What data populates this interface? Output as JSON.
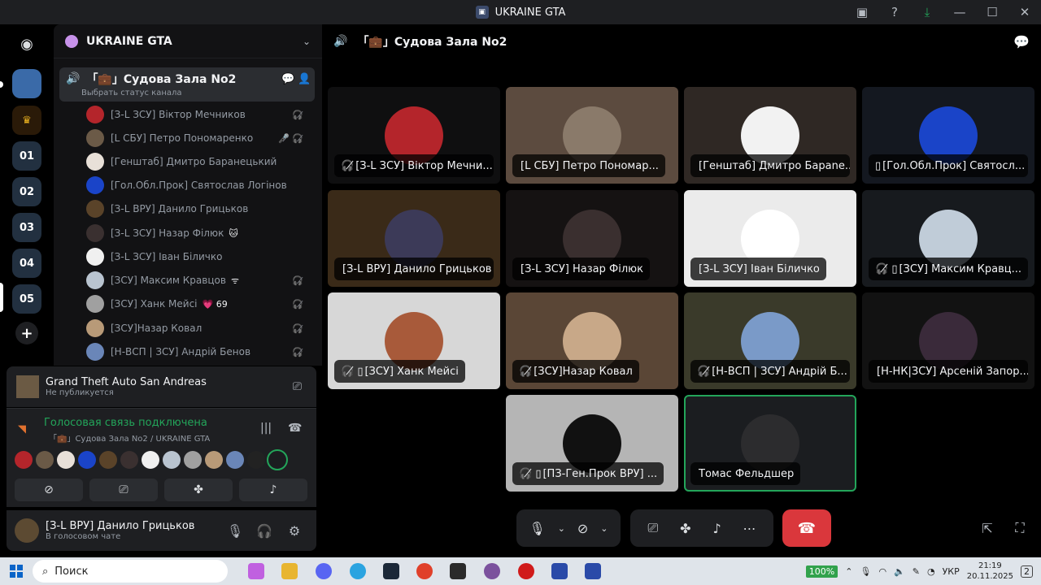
{
  "window": {
    "title": "UKRAINE GTA"
  },
  "server": {
    "name": "UKRAINE GTA"
  },
  "channel": {
    "name": "「💼」Судова Зала No2",
    "status_placeholder": "Выбрать статус канала"
  },
  "members": [
    {
      "name": "[З-L ЗСУ] Віктор Мечников",
      "icon": "deafened-icon",
      "color": "#b4252b"
    },
    {
      "name": "[L СБУ] Петро Пономаренко",
      "icon": "muted-deafened-icon",
      "color": "#6b5a47"
    },
    {
      "name": "[Генштаб] Дмитро Баранецький",
      "icon": "",
      "color": "#e8e0d8"
    },
    {
      "name": "[Гол.Обл.Прок] Святослав Логінов",
      "icon": "",
      "color": "#1a44c8"
    },
    {
      "name": "[З-L ВРУ] Данило Грицьков",
      "icon": "",
      "color": "#5a4329"
    },
    {
      "name": "[З-L ЗСУ] Назар Філюк",
      "badge": "🐱",
      "icon": "",
      "color": "#3a3030"
    },
    {
      "name": "[З-L ЗСУ] Іван Біличко",
      "icon": "",
      "color": "#f0f0f0"
    },
    {
      "name": "[ЗСУ] Максим Кравцов",
      "badge": "ᯤ",
      "icon": "deafened-icon",
      "color": "#b9c4d0"
    },
    {
      "name": "[ЗСУ] Ханк Мейсі",
      "badge": "💗 69",
      "icon": "deafened-icon",
      "color": "#a0a0a0"
    },
    {
      "name": "[ЗСУ]Назар Ковал",
      "icon": "deafened-icon",
      "color": "#b89a78"
    },
    {
      "name": "[Н-ВСП | ЗСУ] Андрій Бенов",
      "icon": "deafened-icon",
      "color": "#6a86b8"
    }
  ],
  "activity": {
    "game": "Grand Theft Auto San Andreas",
    "sub": "Не публикуется"
  },
  "voice": {
    "status": "Голосовая связь подключена",
    "location": "「💼」Судова Зала No2 / UKRAINE GTA"
  },
  "user": {
    "name": "[З-L ВРУ] Данило Грицьков",
    "status": "В голосовом чате"
  },
  "main": {
    "channel_title": "「💼」Судова Зала No2"
  },
  "tiles": [
    {
      "label": "[З-L ЗСУ] Віктор Мечни...",
      "bg": "#0f0f10",
      "av": "#b4252b",
      "prefix": "🎧̸ "
    },
    {
      "label": "[L СБУ] Петро Пономар...",
      "bg": "#5c4b3f",
      "av": "#8a7a6a",
      "prefix": ""
    },
    {
      "label": "[Генштаб] Дмитро Барane...",
      "bg": "#2f2824",
      "av": "#f2f2f2",
      "prefix": ""
    },
    {
      "label": "[Гол.Обл.Прок] Святосл...",
      "bg": "#141820",
      "av": "#1a44c8",
      "prefix": "▯ "
    },
    {
      "label": "[З-L ВРУ] Данило Грицьков",
      "bg": "#3a2a18",
      "av": "#3c3a58",
      "prefix": ""
    },
    {
      "label": "[З-L ЗСУ] Назар Філюк",
      "bg": "#151212",
      "av": "#3a2f2f",
      "prefix": ""
    },
    {
      "label": "[З-L ЗСУ] Іван Біличко",
      "bg": "#ebebeb",
      "av": "#ffffff",
      "prefix": ""
    },
    {
      "label": "[ЗСУ] Максим Кравц...",
      "bg": "#171a1e",
      "av": "#c0ccd8",
      "prefix": "🎧̸ ▯ "
    },
    {
      "label": "[ЗСУ] Ханк Мейсі",
      "bg": "#d7d7d7",
      "av": "#a85a3a",
      "prefix": "🎧̸ ▯ "
    },
    {
      "label": "[ЗСУ]Назар Ковал",
      "bg": "#5a4636",
      "av": "#c8a888",
      "prefix": "🎧̸ "
    },
    {
      "label": "[Н-ВСП | ЗСУ] Андрій Б...",
      "bg": "#3a3a2a",
      "av": "#7a9ac8",
      "prefix": "🎧̸ "
    },
    {
      "label": "[Н-НК|ЗСУ] Арсеній Запор...",
      "bg": "#121212",
      "av": "#3a2a3a",
      "prefix": ""
    },
    {
      "label": "[ПЗ-Ген.Прок ВРУ] ...",
      "bg": "#b5b5b5",
      "av": "#111111",
      "prefix": "🎧̸ ▯ "
    },
    {
      "label": "Томас Фельдшер",
      "bg": "#1b1d20",
      "av": "#2c2c2e",
      "prefix": ""
    }
  ],
  "taskbar": {
    "search_placeholder": "Поиск",
    "battery": "100%",
    "lang": "УКР",
    "time": "21:19",
    "date": "20.11.2025",
    "notifications": "2"
  }
}
